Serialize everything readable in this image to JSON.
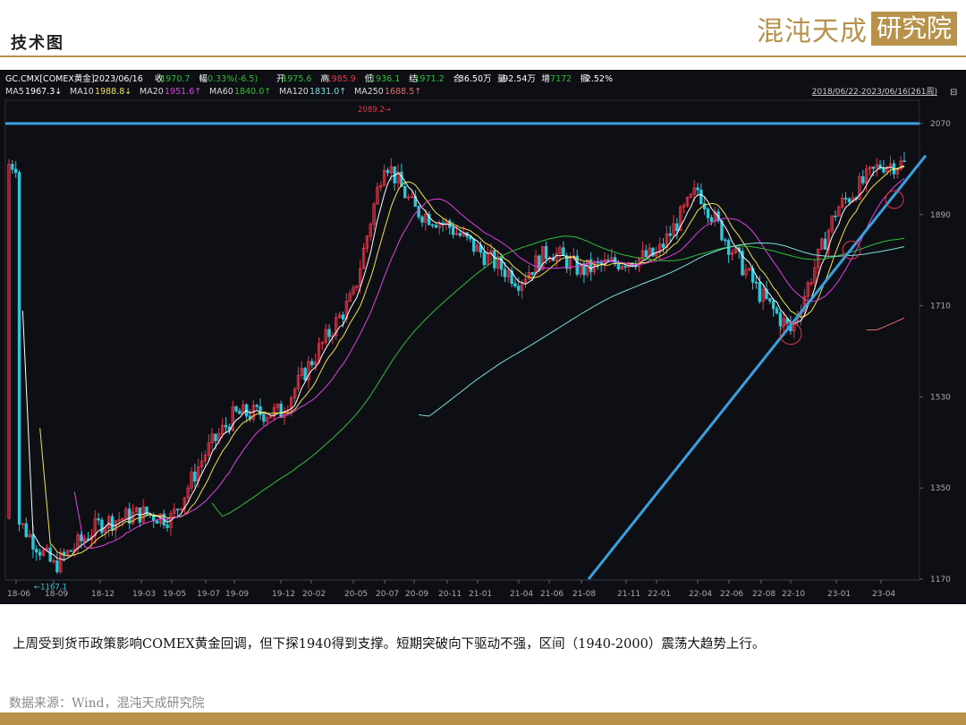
{
  "header": {
    "title": "技术图",
    "logo_brand": "混沌天成",
    "logo_box": "研究院"
  },
  "colors": {
    "gold": "#b8924a",
    "up": "#e8364a",
    "down": "#2ec7d8",
    "ma5": "#ffffff",
    "ma10": "#f2e24a",
    "ma20": "#e040e0",
    "ma60": "#2fbf3a",
    "ma120": "#7fe0d8",
    "ma250": "#e86a6a",
    "resistance": "#3aa0e0"
  },
  "quote": {
    "symbol": "GC.CMX[COMEX黄金]",
    "date": "2023/06/16",
    "close_label": "收",
    "close": "1970.7",
    "change_label": "幅",
    "change": "-0.33%(-6.5)",
    "open_label": "开",
    "open": "1975.6",
    "high_label": "高",
    "high": "1985.9",
    "low_label": "低",
    "low": "1936.1",
    "settle_label": "结",
    "settle": "1971.2",
    "oi_label": "合",
    "oi": "36.50万",
    "vol_label": "量",
    "vol": "92.54万",
    "inc_label": "增",
    "inc": "-7172",
    "amp_label": "振",
    "amp": "2.52%"
  },
  "ma": [
    {
      "label": "MA5",
      "value": "1967.3↓"
    },
    {
      "label": "MA10",
      "value": "1988.8↓"
    },
    {
      "label": "MA20",
      "value": "1951.6↑"
    },
    {
      "label": "MA60",
      "value": "1840.0↑"
    },
    {
      "label": "MA120",
      "value": "1831.0↑"
    },
    {
      "label": "MA250",
      "value": "1688.5↑"
    }
  ],
  "range_label": "2018/06/22-2023/06/16(261周)",
  "chart_data": {
    "type": "candlestick",
    "y_ticks": [
      2070,
      1890,
      1710,
      1530,
      1350,
      1170
    ],
    "ylim": [
      1160,
      2100
    ],
    "x_ticks": [
      "18-06",
      "18-09",
      "18-12",
      "19-03",
      "19-05",
      "19-07",
      "19-09",
      "19-12",
      "20-02",
      "20-05",
      "20-07",
      "20-09",
      "20-11",
      "21-01",
      "21-04",
      "21-06",
      "21-08",
      "21-11",
      "22-01",
      "22-04",
      "22-06",
      "22-08",
      "22-10",
      "23-01",
      "23-04"
    ],
    "annotations": {
      "max": "2089.2",
      "min": "1167.1"
    },
    "resistance_level": 2070,
    "trendline": {
      "from": [
        "21-08",
        1170
      ],
      "to": [
        "23-04",
        1975
      ]
    },
    "key_points": [
      {
        "x": "18-06",
        "y": 1290
      },
      {
        "x": "18-09",
        "y": 1195
      },
      {
        "x": "18-12",
        "y": 1280
      },
      {
        "x": "19-03",
        "y": 1300
      },
      {
        "x": "19-05",
        "y": 1290
      },
      {
        "x": "19-07",
        "y": 1420
      },
      {
        "x": "19-09",
        "y": 1495
      },
      {
        "x": "19-12",
        "y": 1500
      },
      {
        "x": "20-02",
        "y": 1600
      },
      {
        "x": "20-05",
        "y": 1730
      },
      {
        "x": "20-07",
        "y": 2000
      },
      {
        "x": "20-09",
        "y": 1900
      },
      {
        "x": "20-11",
        "y": 1870
      },
      {
        "x": "21-01",
        "y": 1820
      },
      {
        "x": "21-04",
        "y": 1760
      },
      {
        "x": "21-06",
        "y": 1820
      },
      {
        "x": "21-08",
        "y": 1780
      },
      {
        "x": "21-11",
        "y": 1800
      },
      {
        "x": "22-01",
        "y": 1810
      },
      {
        "x": "22-04",
        "y": 1940
      },
      {
        "x": "22-06",
        "y": 1830
      },
      {
        "x": "22-08",
        "y": 1730
      },
      {
        "x": "22-10",
        "y": 1660
      },
      {
        "x": "23-01",
        "y": 1900
      },
      {
        "x": "23-04",
        "y": 1990
      }
    ]
  },
  "caption": "上周受到货币政策影响COMEX黄金回调，但下探1940得到支撑。短期突破向下驱动不强，区间（1940-2000）震荡大趋势上行。",
  "source": "数据来源：Wind，混沌天成研究院"
}
